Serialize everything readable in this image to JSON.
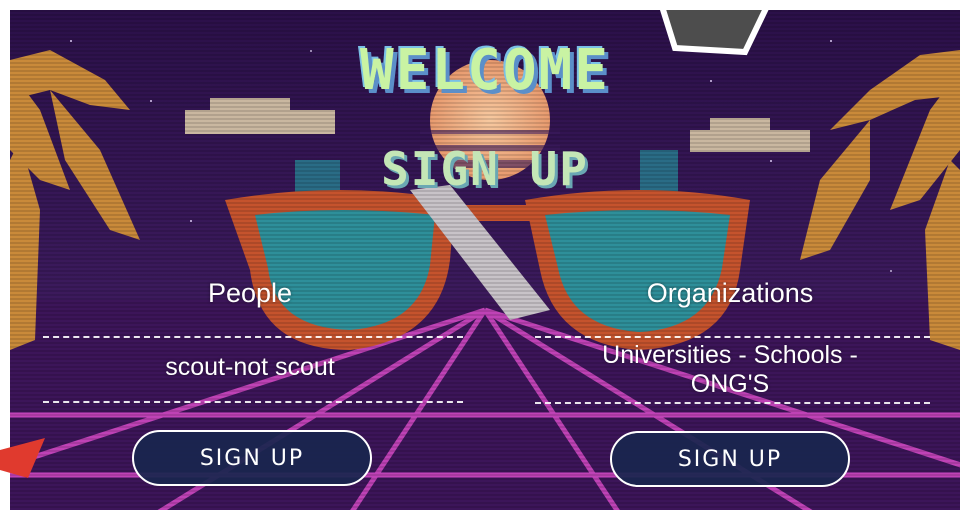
{
  "title": {
    "welcome": "WELCOME",
    "signup": "SIGN UP"
  },
  "left_column": {
    "heading": "People",
    "subheading": "scout-not scout",
    "button_label": "SIGN UP"
  },
  "right_column": {
    "heading": "Organizations",
    "subheading_line1": "Universities - Schools -",
    "subheading_line2": "ONG'S",
    "button_label": "SIGN UP"
  },
  "colors": {
    "background": "#2a1247",
    "grid": "#d64bc7",
    "palm": "#c98a3a",
    "glasses_frame": "#c5532d",
    "lens": "#2e8f9a",
    "button_fill": "#19264e",
    "title_green": "#c9f3a3"
  }
}
